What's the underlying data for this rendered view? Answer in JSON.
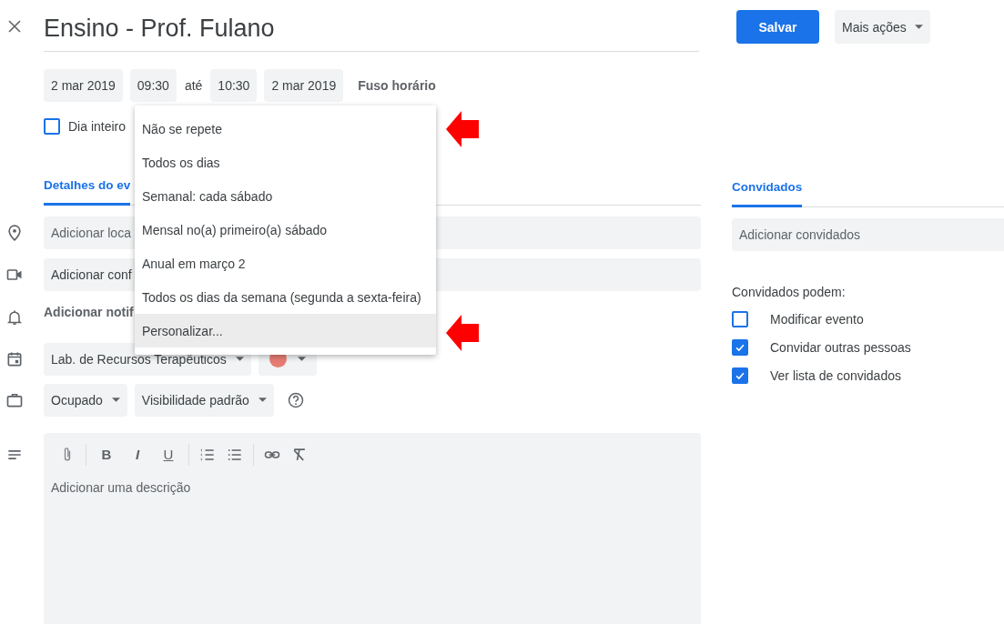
{
  "title": "Ensino - Prof. Fulano",
  "actions": {
    "save": "Salvar",
    "more": "Mais ações"
  },
  "dates": {
    "start_date": "2 mar 2019",
    "start_time": "09:30",
    "separator": "até",
    "end_time": "10:30",
    "end_date": "2 mar 2019",
    "timezone": "Fuso horário"
  },
  "all_day": {
    "label": "Dia inteiro",
    "checked": false
  },
  "recurrence_menu": {
    "items": [
      {
        "label": "Não se repete",
        "highlighted": false
      },
      {
        "label": "Todos os dias",
        "highlighted": false
      },
      {
        "label": "Semanal: cada sábado",
        "highlighted": false
      },
      {
        "label": "Mensal no(a) primeiro(a) sábado",
        "highlighted": false
      },
      {
        "label": "Anual em março 2",
        "highlighted": false
      },
      {
        "label": "Todos os dias da semana (segunda a sexta-feira)",
        "highlighted": false
      },
      {
        "label": "Personalizar...",
        "highlighted": true
      }
    ]
  },
  "details_tab": {
    "label": "Detalhes do ev",
    "selected": true
  },
  "location": {
    "placeholder": "Adicionar loca"
  },
  "conference": {
    "label": "Adicionar conf"
  },
  "notification": {
    "label": "Adicionar notif"
  },
  "calendar": {
    "name": "Lab. de Recursos Terapêuticos",
    "color": "#e67c73"
  },
  "availability": "Ocupado",
  "visibility": "Visibilidade padrão",
  "format_buttons": [
    {
      "glyph": "B",
      "kind": "bold"
    },
    {
      "glyph": "I",
      "kind": "italic"
    },
    {
      "glyph": "U",
      "kind": "underline"
    }
  ],
  "description": {
    "placeholder": "Adicionar uma descrição"
  },
  "guests_tab": {
    "label": "Convidados",
    "selected": true
  },
  "guests_field": {
    "placeholder": "Adicionar convidados"
  },
  "permissions": {
    "title": "Convidados podem:",
    "items": [
      {
        "label": "Modificar evento",
        "checked": false
      },
      {
        "label": "Convidar outras pessoas",
        "checked": true
      },
      {
        "label": "Ver lista de convidados",
        "checked": true
      }
    ]
  }
}
